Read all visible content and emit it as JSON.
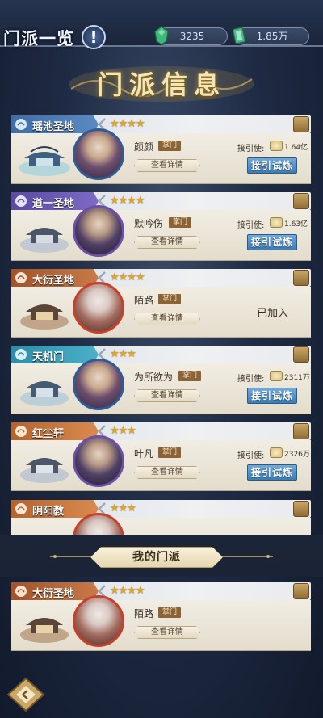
{
  "header": {
    "title": "门派一览",
    "info_label": "!",
    "jade": "3235",
    "coins": "1.85万"
  },
  "banner": {
    "title": "门派信息"
  },
  "labels": {
    "recruit": "接引使:",
    "details": "查看详情",
    "leader_tag": "掌门",
    "trial": "接引试炼",
    "joined": "已加入"
  },
  "sects": [
    {
      "name": "瑶池圣地",
      "stars": "★★★★",
      "leader": "颜颜",
      "recruit_value": "1.64亿",
      "status": "trial",
      "theme": "blue"
    },
    {
      "name": "道一圣地",
      "stars": "★★★★",
      "leader": "默吟伤",
      "recruit_value": "1.63亿",
      "status": "trial",
      "theme": "purple"
    },
    {
      "name": "大衍圣地",
      "stars": "★★★★",
      "leader": "陌路",
      "recruit_value": "",
      "status": "joined",
      "theme": "gold"
    },
    {
      "name": "天机门",
      "stars": "★★★",
      "leader": "为所欲为",
      "recruit_value": "2311万",
      "status": "trial",
      "theme": "cyan"
    },
    {
      "name": "红尘轩",
      "stars": "★★★",
      "leader": "叶凡",
      "recruit_value": "2326万",
      "status": "trial",
      "theme": "orange"
    },
    {
      "name": "阴阳教",
      "stars": "★★★",
      "leader": "",
      "recruit_value": "",
      "status": "partial",
      "theme": "orange"
    }
  ],
  "my_sect": {
    "heading": "我的门派",
    "name": "大衍圣地",
    "stars": "★★★★",
    "leader": "陌路"
  },
  "colors": {
    "background": "#1f2b44",
    "card": "#ece6d8",
    "trial_button": "#4a89c0",
    "star": "#e0a52c"
  }
}
